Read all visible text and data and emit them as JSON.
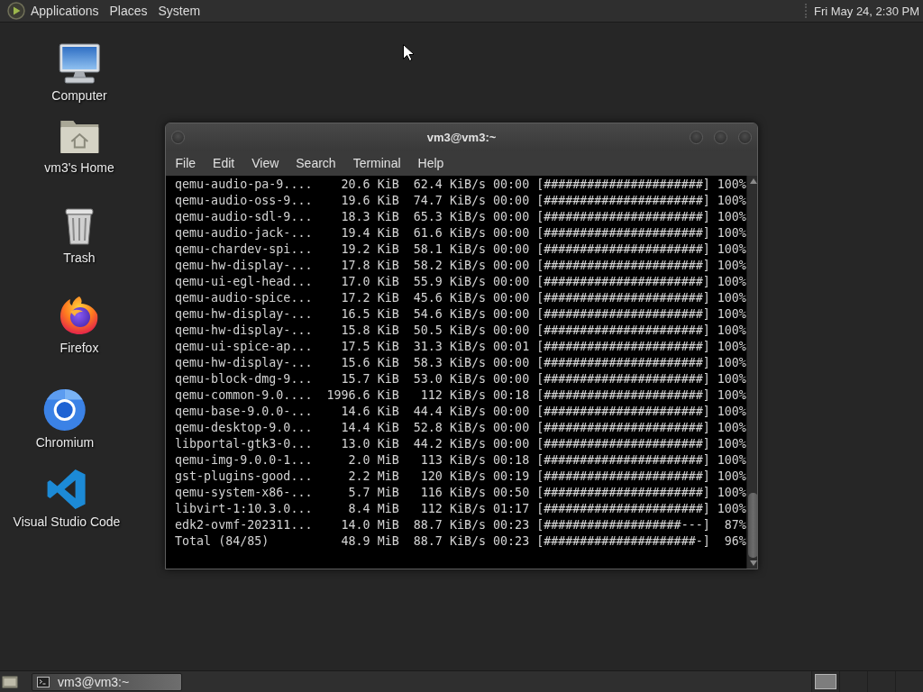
{
  "top_panel": {
    "menus": [
      "Applications",
      "Places",
      "System"
    ],
    "clock": "Fri May 24, 2:30 PM"
  },
  "desktop_icons": [
    {
      "label": "Computer",
      "kind": "computer"
    },
    {
      "label": "vm3's Home",
      "kind": "home"
    },
    {
      "label": "Trash",
      "kind": "trash"
    },
    {
      "label": "Firefox",
      "kind": "firefox"
    },
    {
      "label": "Chromium",
      "kind": "chromium"
    },
    {
      "label": "Visual Studio Code",
      "kind": "vscode"
    }
  ],
  "terminal_window": {
    "title": "vm3@vm3:~",
    "menu": [
      "File",
      "Edit",
      "View",
      "Search",
      "Terminal",
      "Help"
    ],
    "lines": [
      {
        "name": "qemu-audio-pa-9....",
        "size": "20.6 KiB",
        "speed": "62.4 KiB/s",
        "eta": "00:00",
        "progress": "[######################]",
        "percent": "100%"
      },
      {
        "name": "qemu-audio-oss-9...",
        "size": "19.6 KiB",
        "speed": "74.7 KiB/s",
        "eta": "00:00",
        "progress": "[######################]",
        "percent": "100%"
      },
      {
        "name": "qemu-audio-sdl-9...",
        "size": "18.3 KiB",
        "speed": "65.3 KiB/s",
        "eta": "00:00",
        "progress": "[######################]",
        "percent": "100%"
      },
      {
        "name": "qemu-audio-jack-...",
        "size": "19.4 KiB",
        "speed": "61.6 KiB/s",
        "eta": "00:00",
        "progress": "[######################]",
        "percent": "100%"
      },
      {
        "name": "qemu-chardev-spi...",
        "size": "19.2 KiB",
        "speed": "58.1 KiB/s",
        "eta": "00:00",
        "progress": "[######################]",
        "percent": "100%"
      },
      {
        "name": "qemu-hw-display-...",
        "size": "17.8 KiB",
        "speed": "58.2 KiB/s",
        "eta": "00:00",
        "progress": "[######################]",
        "percent": "100%"
      },
      {
        "name": "qemu-ui-egl-head...",
        "size": "17.0 KiB",
        "speed": "55.9 KiB/s",
        "eta": "00:00",
        "progress": "[######################]",
        "percent": "100%"
      },
      {
        "name": "qemu-audio-spice...",
        "size": "17.2 KiB",
        "speed": "45.6 KiB/s",
        "eta": "00:00",
        "progress": "[######################]",
        "percent": "100%"
      },
      {
        "name": "qemu-hw-display-...",
        "size": "16.5 KiB",
        "speed": "54.6 KiB/s",
        "eta": "00:00",
        "progress": "[######################]",
        "percent": "100%"
      },
      {
        "name": "qemu-hw-display-...",
        "size": "15.8 KiB",
        "speed": "50.5 KiB/s",
        "eta": "00:00",
        "progress": "[######################]",
        "percent": "100%"
      },
      {
        "name": "qemu-ui-spice-ap...",
        "size": "17.5 KiB",
        "speed": "31.3 KiB/s",
        "eta": "00:01",
        "progress": "[######################]",
        "percent": "100%"
      },
      {
        "name": "qemu-hw-display-...",
        "size": "15.6 KiB",
        "speed": "58.3 KiB/s",
        "eta": "00:00",
        "progress": "[######################]",
        "percent": "100%"
      },
      {
        "name": "qemu-block-dmg-9...",
        "size": "15.7 KiB",
        "speed": "53.0 KiB/s",
        "eta": "00:00",
        "progress": "[######################]",
        "percent": "100%"
      },
      {
        "name": "qemu-common-9.0....",
        "size": "1996.6 KiB",
        "speed": "112 KiB/s",
        "eta": "00:18",
        "progress": "[######################]",
        "percent": "100%"
      },
      {
        "name": "qemu-base-9.0.0-...",
        "size": "14.6 KiB",
        "speed": "44.4 KiB/s",
        "eta": "00:00",
        "progress": "[######################]",
        "percent": "100%"
      },
      {
        "name": "qemu-desktop-9.0...",
        "size": "14.4 KiB",
        "speed": "52.8 KiB/s",
        "eta": "00:00",
        "progress": "[######################]",
        "percent": "100%"
      },
      {
        "name": "libportal-gtk3-0...",
        "size": "13.0 KiB",
        "speed": "44.2 KiB/s",
        "eta": "00:00",
        "progress": "[######################]",
        "percent": "100%"
      },
      {
        "name": "qemu-img-9.0.0-1...",
        "size": "2.0 MiB",
        "speed": "113 KiB/s",
        "eta": "00:18",
        "progress": "[######################]",
        "percent": "100%"
      },
      {
        "name": "gst-plugins-good...",
        "size": "2.2 MiB",
        "speed": "120 KiB/s",
        "eta": "00:19",
        "progress": "[######################]",
        "percent": "100%"
      },
      {
        "name": "qemu-system-x86-...",
        "size": "5.7 MiB",
        "speed": "116 KiB/s",
        "eta": "00:50",
        "progress": "[######################]",
        "percent": "100%"
      },
      {
        "name": "libvirt-1:10.3.0...",
        "size": "8.4 MiB",
        "speed": "112 KiB/s",
        "eta": "01:17",
        "progress": "[######################]",
        "percent": "100%"
      },
      {
        "name": "edk2-ovmf-202311...",
        "size": "14.0 MiB",
        "speed": "88.7 KiB/s",
        "eta": "00:23",
        "progress": "[###################---]",
        "percent": "87%"
      },
      {
        "name": "Total (84/85)",
        "size": "48.9 MiB",
        "speed": "88.7 KiB/s",
        "eta": "00:23",
        "progress": "[#####################-]",
        "percent": "96%"
      }
    ]
  },
  "taskbar": {
    "tasks": [
      {
        "label": "vm3@vm3:~",
        "selected": true
      }
    ],
    "workspaces": [
      {
        "selected": true
      },
      {
        "selected": false
      },
      {
        "selected": false
      },
      {
        "selected": false
      }
    ]
  }
}
